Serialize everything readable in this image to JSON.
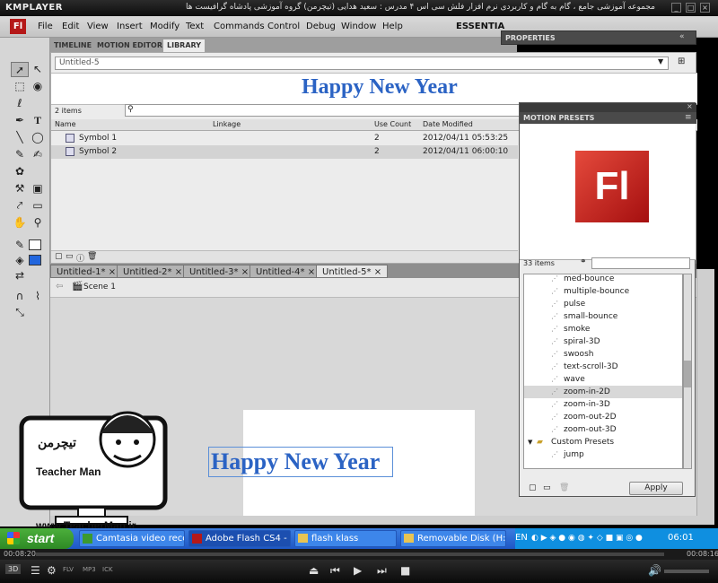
{
  "player": {
    "logo": "KMPLAYER",
    "title": "مجموعه آموزشی جامع ، گام به گام و کاربردی نرم افزار فلش سی اس ۴ مدرس : سعید هدایی (تیچرمن) گروه آموزشی پادشاه گرافیست ها",
    "time_elapsed": "00:08:20",
    "time_total": "00:08:16",
    "badges": [
      "3D",
      "FLV",
      "MP3",
      "ICK"
    ]
  },
  "app": {
    "logo": "Fl",
    "menu": [
      "File",
      "Edit",
      "View",
      "Insert",
      "Modify",
      "Text",
      "Commands",
      "Control",
      "Debug",
      "Window",
      "Help"
    ],
    "workspace": "ESSENTIA"
  },
  "library": {
    "tabs": [
      "TIMELINE",
      "MOTION EDITOR",
      "LIBRARY"
    ],
    "document": "Untitled-5",
    "preview_text": "Happy New Year",
    "item_count": "2 items",
    "columns": [
      "Name",
      "Linkage",
      "Use Count",
      "Date Modified"
    ],
    "rows": [
      {
        "name": "Symbol 1",
        "use_count": "2",
        "date": "2012/04/11  05:53:25"
      },
      {
        "name": "Symbol 2",
        "use_count": "2",
        "date": "2012/04/11  06:00:10"
      }
    ]
  },
  "doc_tabs": [
    "Untitled-1*",
    "Untitled-2*",
    "Untitled-3*",
    "Untitled-4*",
    "Untitled-5*"
  ],
  "scene": "Scene 1",
  "stage_text": "Happy New Year",
  "properties": {
    "title": "PROPERTIES"
  },
  "motion_presets": {
    "title": "MOTION PRESETS",
    "logo": "Fl",
    "count": "33 items",
    "items": [
      "med-bounce",
      "multiple-bounce",
      "pulse",
      "small-bounce",
      "smoke",
      "spiral-3D",
      "swoosh",
      "text-scroll-3D",
      "wave",
      "zoom-in-2D",
      "zoom-in-3D",
      "zoom-out-2D",
      "zoom-out-3D"
    ],
    "selected": "zoom-in-2D",
    "folder": "Custom Presets",
    "folder_items": [
      "jump"
    ],
    "apply_label": "Apply"
  },
  "watermark": {
    "url": "www.TeacherMan.ir",
    "name": "Teacher Man"
  },
  "taskbar": {
    "start": "start",
    "tasks": [
      "Camtasia video reco...",
      "Adobe Flash CS4 - U...",
      "flash klass",
      "Removable Disk (H:)"
    ],
    "lang": "EN",
    "clock": "06:01"
  },
  "colors": {
    "accent_blue": "#2b63c4",
    "flash_red": "#b51818",
    "taskbar_blue": "#245edb",
    "start_green": "#3c9a30"
  }
}
